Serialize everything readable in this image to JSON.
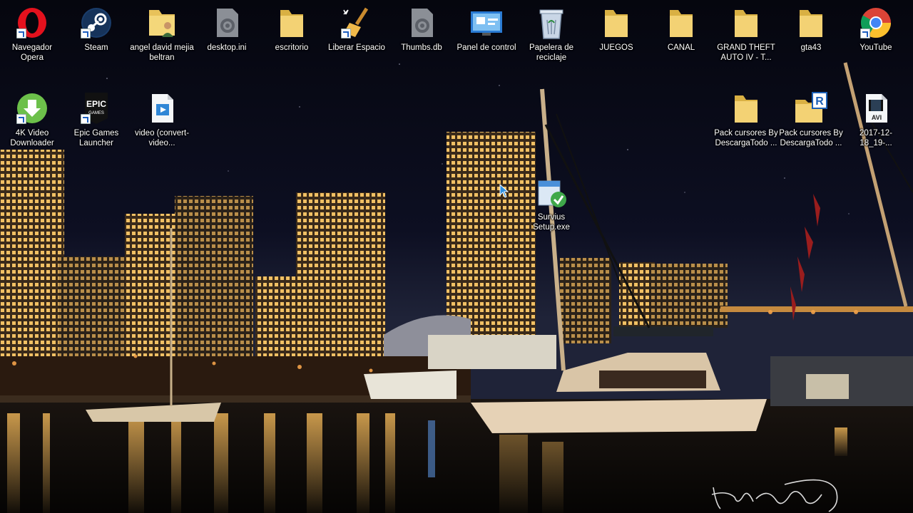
{
  "desktop": {
    "icons": [
      {
        "label": "Navegador Opera",
        "icon": "opera-icon"
      },
      {
        "label": "Steam",
        "icon": "steam-icon"
      },
      {
        "label": "angel david mejia beltran",
        "icon": "user-folder-icon"
      },
      {
        "label": "desktop.ini",
        "icon": "settings-file-icon"
      },
      {
        "label": "escritorio",
        "icon": "folder-icon"
      },
      {
        "label": "Liberar Espacio",
        "icon": "cleanup-broom-icon"
      },
      {
        "label": "Thumbs.db",
        "icon": "settings-file-icon"
      },
      {
        "label": "Panel de control",
        "icon": "control-panel-icon"
      },
      {
        "label": "Papelera de reciclaje",
        "icon": "recycle-bin-icon"
      },
      {
        "label": "JUEGOS",
        "icon": "folder-icon"
      },
      {
        "label": "CANAL",
        "icon": "folder-icon"
      },
      {
        "label": "GRAND THEFT AUTO IV - T...",
        "icon": "folder-icon"
      },
      {
        "label": "gta43",
        "icon": "folder-icon"
      },
      {
        "label": "YouTube",
        "icon": "chrome-icon"
      },
      {
        "label": "4K Video Downloader",
        "icon": "download-icon"
      },
      {
        "label": "Epic Games Launcher",
        "icon": "epic-games-icon"
      },
      {
        "label": "video (convert-video...",
        "icon": "media-file-icon"
      },
      {
        "label": "Pack cursores By DescargaTodo ...",
        "icon": "folder-icon"
      },
      {
        "label": "Pack cursores By DescargaTodo ...",
        "icon": "rar-archive-icon"
      },
      {
        "label": "2017-12-18_19-...",
        "icon": "avi-file-icon"
      },
      {
        "label": "Survius Setup.exe",
        "icon": "installer-icon"
      }
    ]
  },
  "wallpaper": {
    "signature_text": "Yalha Bu Yarig",
    "colors": {
      "sky": "#0b0c1a",
      "water": "#080808",
      "lights": "#f5b84a"
    }
  }
}
